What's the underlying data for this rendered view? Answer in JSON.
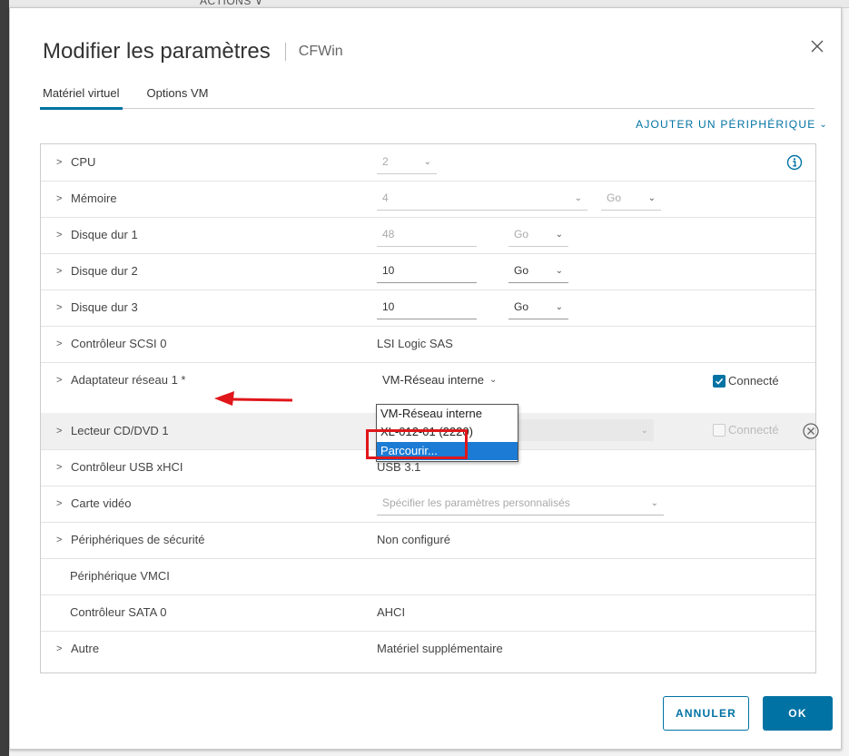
{
  "background": {
    "actions_label": "ACTIONS ∨"
  },
  "dialog": {
    "title": "Modifier les paramètres",
    "subtitle": "CFWin"
  },
  "tabs": [
    {
      "label": "Matériel virtuel",
      "active": true
    },
    {
      "label": "Options VM",
      "active": false
    }
  ],
  "add_device": {
    "label": "AJOUTER UN PÉRIPHÉRIQUE",
    "icon": "chevron-down-icon"
  },
  "rows": {
    "cpu": {
      "label": "CPU",
      "value": "2"
    },
    "memory": {
      "label": "Mémoire",
      "value": "4",
      "unit": "Go"
    },
    "disk1": {
      "label": "Disque dur 1",
      "value": "48",
      "unit": "Go"
    },
    "disk2": {
      "label": "Disque dur 2",
      "value": "10",
      "unit": "Go"
    },
    "disk3": {
      "label": "Disque dur 3",
      "value": "10",
      "unit": "Go"
    },
    "scsi": {
      "label": "Contrôleur SCSI 0",
      "value": "LSI Logic SAS"
    },
    "network": {
      "label": "Adaptateur réseau 1 *",
      "value": "VM-Réseau interne",
      "connected_label": "Connecté",
      "connected": true
    },
    "cdrom": {
      "label": "Lecteur CD/DVD 1",
      "connected_label": "Connecté",
      "connected": false
    },
    "usb": {
      "label": "Contrôleur USB xHCI",
      "value": "USB 3.1"
    },
    "video": {
      "label": "Carte vidéo",
      "value": "Spécifier les paramètres personnalisés"
    },
    "security": {
      "label": "Périphériques de sécurité",
      "value": "Non configuré"
    },
    "vmci": {
      "label": "Périphérique VMCI"
    },
    "sata": {
      "label": "Contrôleur SATA 0",
      "value": "AHCI"
    },
    "other": {
      "label": "Autre",
      "value": "Matériel supplémentaire"
    }
  },
  "network_dropdown": {
    "options": [
      "VM-Réseau interne",
      "XL-012-01 (2220)",
      "Parcourir..."
    ],
    "selected": "Parcourir..."
  },
  "footer": {
    "cancel_label": "ANNULER",
    "ok_label": "OK"
  },
  "colors": {
    "accent": "#0072a3",
    "highlight": "#e0161a",
    "selected_option": "#1c7bd4"
  }
}
